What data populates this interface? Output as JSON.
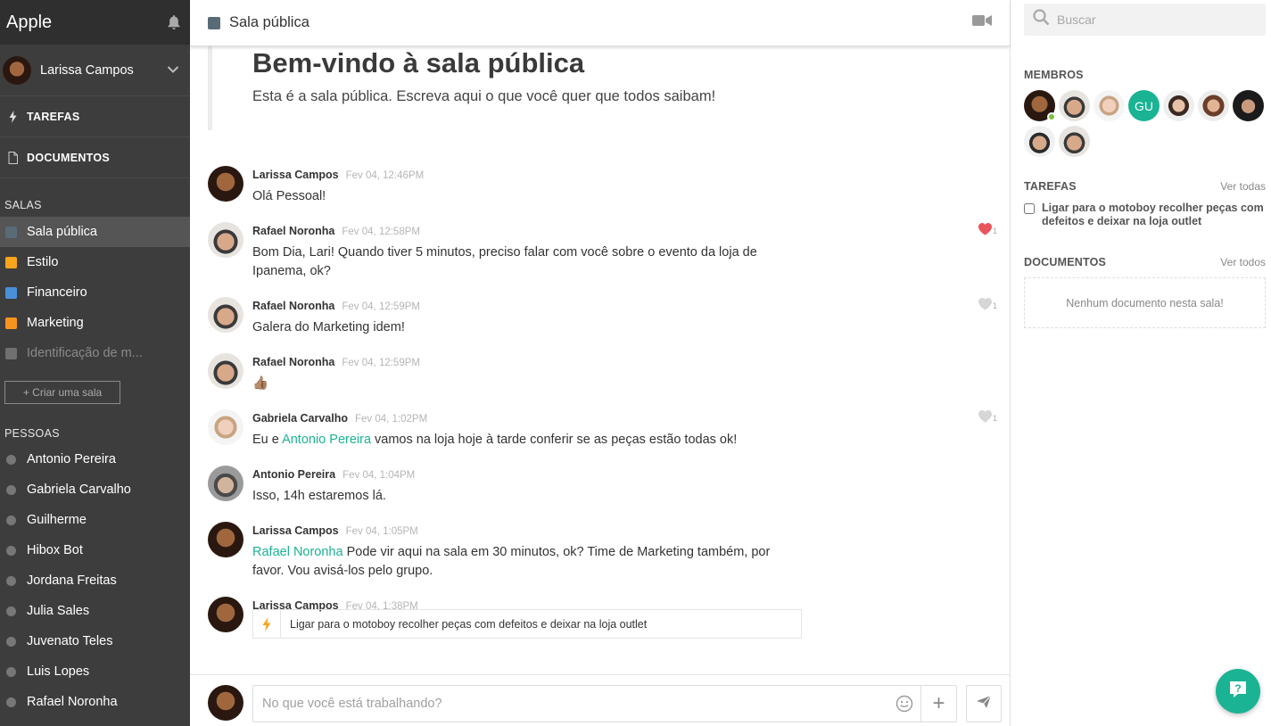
{
  "sidebar": {
    "brand": "Apple",
    "user": {
      "name": "Larissa Campos"
    },
    "nav": [
      {
        "label": "TAREFAS",
        "icon": "bolt-icon"
      },
      {
        "label": "DOCUMENTOS",
        "icon": "document-icon"
      }
    ],
    "rooms_title": "SALAS",
    "rooms": [
      {
        "label": "Sala pública",
        "color": "#5a6b78",
        "active": true
      },
      {
        "label": "Estilo",
        "color": "#f7a51c"
      },
      {
        "label": "Financeiro",
        "color": "#4a90d9"
      },
      {
        "label": "Marketing",
        "color": "#f7941d"
      },
      {
        "label": "Identificação de m...",
        "color": "#707070",
        "muted": true
      }
    ],
    "create_room": "+ Criar uma sala",
    "people_title": "PESSOAS",
    "people": [
      "Antonio Pereira",
      "Gabriela Carvalho",
      "Guilherme",
      "Hibox Bot",
      "Jordana Freitas",
      "Julia Sales",
      "Juvenato Teles",
      "Luis Lopes",
      "Rafael Noronha"
    ]
  },
  "main": {
    "title": "Sala pública",
    "welcome_title": "Bem-vindo à sala pública",
    "welcome_text": "Esta é a sala pública. Escreva aqui o que você quer que todos saibam!",
    "messages": [
      {
        "author": "Larissa Campos",
        "time": "Fev 04, 12:46PM",
        "text": "Olá Pessoal!",
        "avatar": "larissa"
      },
      {
        "author": "Rafael Noronha",
        "time": "Fev 04, 12:58PM",
        "text": "Bom Dia, Lari! Quando tiver 5 minutos, preciso falar com você sobre o evento da loja de Ipanema, ok?",
        "avatar": "rafael",
        "likes": "1",
        "liked": true
      },
      {
        "author": "Rafael Noronha",
        "time": "Fev 04, 12:59PM",
        "text": "Galera do Marketing idem!",
        "avatar": "rafael",
        "likes": "1"
      },
      {
        "author": "Rafael Noronha",
        "time": "Fev 04, 12:59PM",
        "text": "👍🏽",
        "avatar": "rafael"
      },
      {
        "author": "Gabriela Carvalho",
        "time": "Fev 04, 1:02PM",
        "text_pre": "Eu e ",
        "mention": "Antonio Pereira",
        "text_post": " vamos na loja hoje à tarde conferir se as peças estão todas ok!",
        "avatar": "gabriela",
        "likes": "1"
      },
      {
        "author": "Antonio Pereira",
        "time": "Fev 04, 1:04PM",
        "text": "Isso, 14h estaremos lá.",
        "avatar": "antonio"
      },
      {
        "author": "Larissa Campos",
        "time": "Fev 04, 1:05PM",
        "mention": "Rafael Noronha",
        "text_post": " Pode vir aqui na sala em 30 minutos, ok? Time de Marketing também, por favor. Vou avisá-los pelo grupo.",
        "avatar": "larissa"
      },
      {
        "author": "Larissa Campos",
        "time": "Fev 04, 1:38PM",
        "task": "Ligar para o motoboy recolher peças com defeitos e deixar na loja outlet",
        "avatar": "larissa"
      }
    ],
    "composer_placeholder": "No que você está trabalhando?",
    "plus_label": "+"
  },
  "right": {
    "search_placeholder": "Buscar",
    "members_title": "MEMBROS",
    "members_initials": "GU",
    "tasks_title": "TAREFAS",
    "see_all": "Ver todas",
    "see_all_docs": "Ver todos",
    "task": "Ligar para o motoboy recolher peças com defeitos e deixar na loja outlet",
    "docs_title": "DOCUMENTOS",
    "docs_empty": "Nenhum documento nesta sala!"
  },
  "colors": {
    "accent": "#1ab394",
    "heart": "#e8555a",
    "sidebar": "#3d3d3d"
  }
}
